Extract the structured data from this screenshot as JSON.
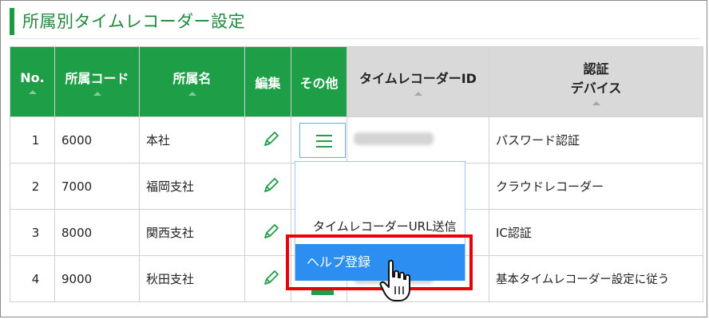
{
  "page": {
    "title": "所属別タイムレコーダー設定"
  },
  "columns": {
    "no": "No.",
    "code": "所属コード",
    "name": "所属名",
    "edit": "編集",
    "other": "その他",
    "recorder_id": "タイムレコーダーID",
    "auth_line1": "認証",
    "auth_line2": "デバイス"
  },
  "rows": [
    {
      "no": "1",
      "code": "6000",
      "name": "本社",
      "auth": "パスワード認証"
    },
    {
      "no": "2",
      "code": "7000",
      "name": "福岡支社",
      "auth": "クラウドレコーダー"
    },
    {
      "no": "3",
      "code": "8000",
      "name": "関西支社",
      "auth": "IC認証"
    },
    {
      "no": "4",
      "code": "9000",
      "name": "秋田支社",
      "auth": "基本タイムレコーダー設定に従う"
    }
  ],
  "dropdown": {
    "item_send_url": "タイムレコーダーURL送信",
    "item_help": "ヘルプ登録"
  },
  "colors": {
    "accent_green": "#1e9e46",
    "menu_highlight": "#2d8ef2",
    "callout_red": "#e8000b"
  },
  "icons": {
    "edit": "pencil-icon",
    "menu": "hamburger-icon",
    "cursor": "hand-pointer-icon"
  }
}
